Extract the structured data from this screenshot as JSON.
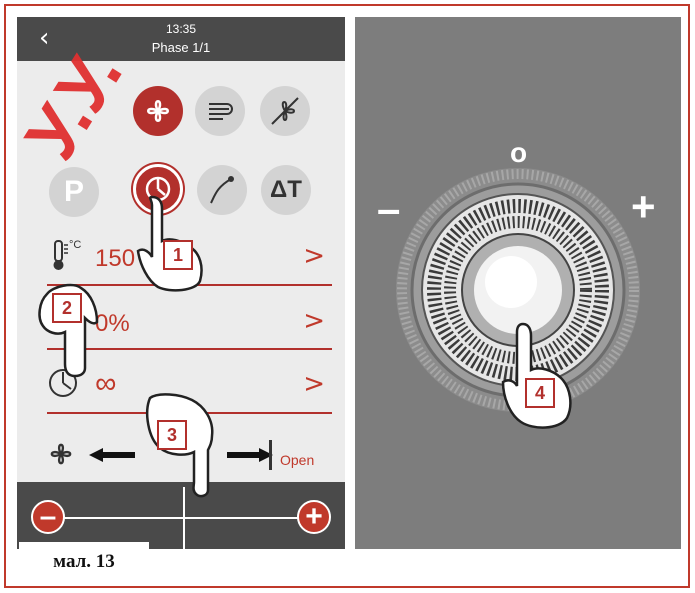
{
  "header": {
    "time": "13:35",
    "phase": "Phase 1/1",
    "back_icon": "chevron-left-icon"
  },
  "icons_row1": [
    "fan-icon",
    "steam-icon",
    "fan-off-icon"
  ],
  "icons_row2": {
    "p_label": "P",
    "timer_icon": "timer-icon",
    "probe_icon": "probe-icon",
    "delta_label": "ΔT"
  },
  "rows": [
    {
      "icon": "thermometer-icon",
      "unit": "°C",
      "value": "150",
      "chevron": ">"
    },
    {
      "icon": "humidity-icon",
      "value": "0%",
      "chevron": ">"
    },
    {
      "icon": "clock-icon",
      "value": "∞",
      "chevron": ">"
    }
  ],
  "fan_row": {
    "icon": "fan-icon",
    "open_label": "Open"
  },
  "slider": {
    "minus_label": "–",
    "plus_label": "+"
  },
  "knob": {
    "zero_label": "o",
    "minus_label": "–",
    "plus_label": "+"
  },
  "steps": [
    "1",
    "2",
    "3",
    "4"
  ],
  "caption": "мал. 13",
  "colors": {
    "accent": "#b2302c",
    "bar": "#4a4a4a",
    "panel_bg": "#ececec",
    "knob_bg": "#7d7d7d"
  }
}
